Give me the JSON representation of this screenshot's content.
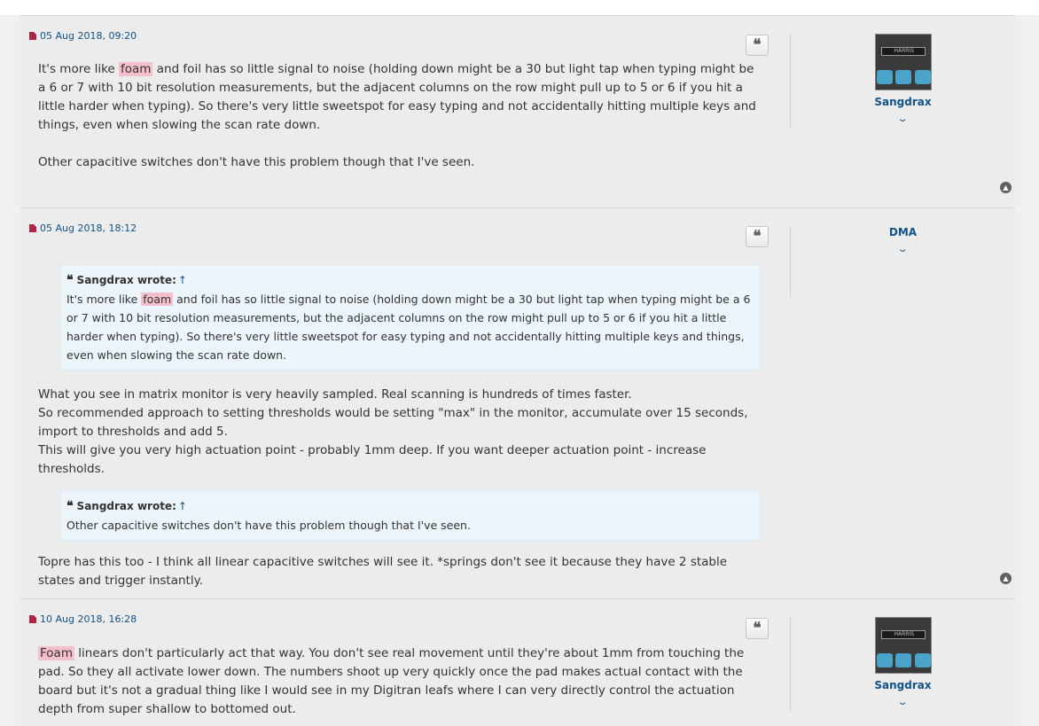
{
  "posts": [
    {
      "date": "05 Aug 2018, 09:20",
      "author": "Sangdrax",
      "has_avatar": true,
      "body": [
        {
          "segments": [
            {
              "text": "It's more like ",
              "highlight": false
            },
            {
              "text": "foam",
              "highlight": true
            },
            {
              "text": " and foil has so little signal to noise (holding down might be a 30 but light tap when typing might be a 6 or 7 with 10 bit resolution measurements, but the adjacent columns on the row might pull up to 5 or 6 if you hit a little harder when typing). So there's very little sweetspot for easy typing and not accidentally hitting multiple keys and things, even when slowing the scan rate down.",
              "highlight": false
            }
          ]
        },
        {
          "segments": [
            {
              "text": "Other capacitive switches don't have this problem though that I've seen.",
              "highlight": false
            }
          ]
        }
      ]
    },
    {
      "date": "05 Aug 2018, 18:12",
      "author": "DMA",
      "has_avatar": false,
      "quote1": {
        "cite": "Sangdrax wrote:",
        "segments": [
          {
            "text": "It's more like ",
            "highlight": false
          },
          {
            "text": "foam",
            "highlight": true
          },
          {
            "text": " and foil has so little signal to noise (holding down might be a 30 but light tap when typing might be a 6 or 7 with 10 bit resolution measurements, but the adjacent columns on the row might pull up to 5 or 6 if you hit a little harder when typing). So there's very little sweetspot for easy typing and not accidentally hitting multiple keys and things, even when slowing the scan rate down.",
            "highlight": false
          }
        ]
      },
      "para1": [
        "What you see in matrix monitor is very heavily sampled. Real scanning is hundreds of times faster.",
        "So recommended approach to setting thresholds would be setting \"max\" in the monitor, accumulate over 15 seconds, import to thresholds and add 5.",
        "This will give you very high actuation point - probably 1mm deep. If you want deeper actuation point - increase thresholds."
      ],
      "quote2": {
        "cite": "Sangdrax wrote:",
        "text": "Other capacitive switches don't have this problem though that I've seen."
      },
      "para2": "Topre has this too - I think all linear capacitive switches will see it. *springs don't see it because they have 2 stable states and trigger instantly."
    },
    {
      "date": "10 Aug 2018, 16:28",
      "author": "Sangdrax",
      "has_avatar": true,
      "body": [
        {
          "segments": [
            {
              "text": "Foam",
              "highlight": true
            },
            {
              "text": " linears don't particularly act that way. You don't see real movement until they're about 1mm from touching the pad. So they all activate lower down. The numbers shoot up very quickly once the pad makes actual contact with the board but it's not a gradual thing like I would see in my Digitran leafs where I can very directly control the actuation depth from super shallow to bottomed out.",
              "highlight": false
            }
          ]
        }
      ]
    }
  ],
  "icons": {
    "post": "post-icon",
    "quote": "quote-icon",
    "top": "back-to-top-icon",
    "chevron": "chevron-down-icon"
  },
  "glyphs": {
    "quote_button": "❝",
    "up_arrow": "↑",
    "chevron": "⌄",
    "top": "▲"
  },
  "colors": {
    "link": "#105289",
    "highlight": "#f5c0cb",
    "quote_bg": "#ebf5fb",
    "post_bg": "#ececec"
  }
}
